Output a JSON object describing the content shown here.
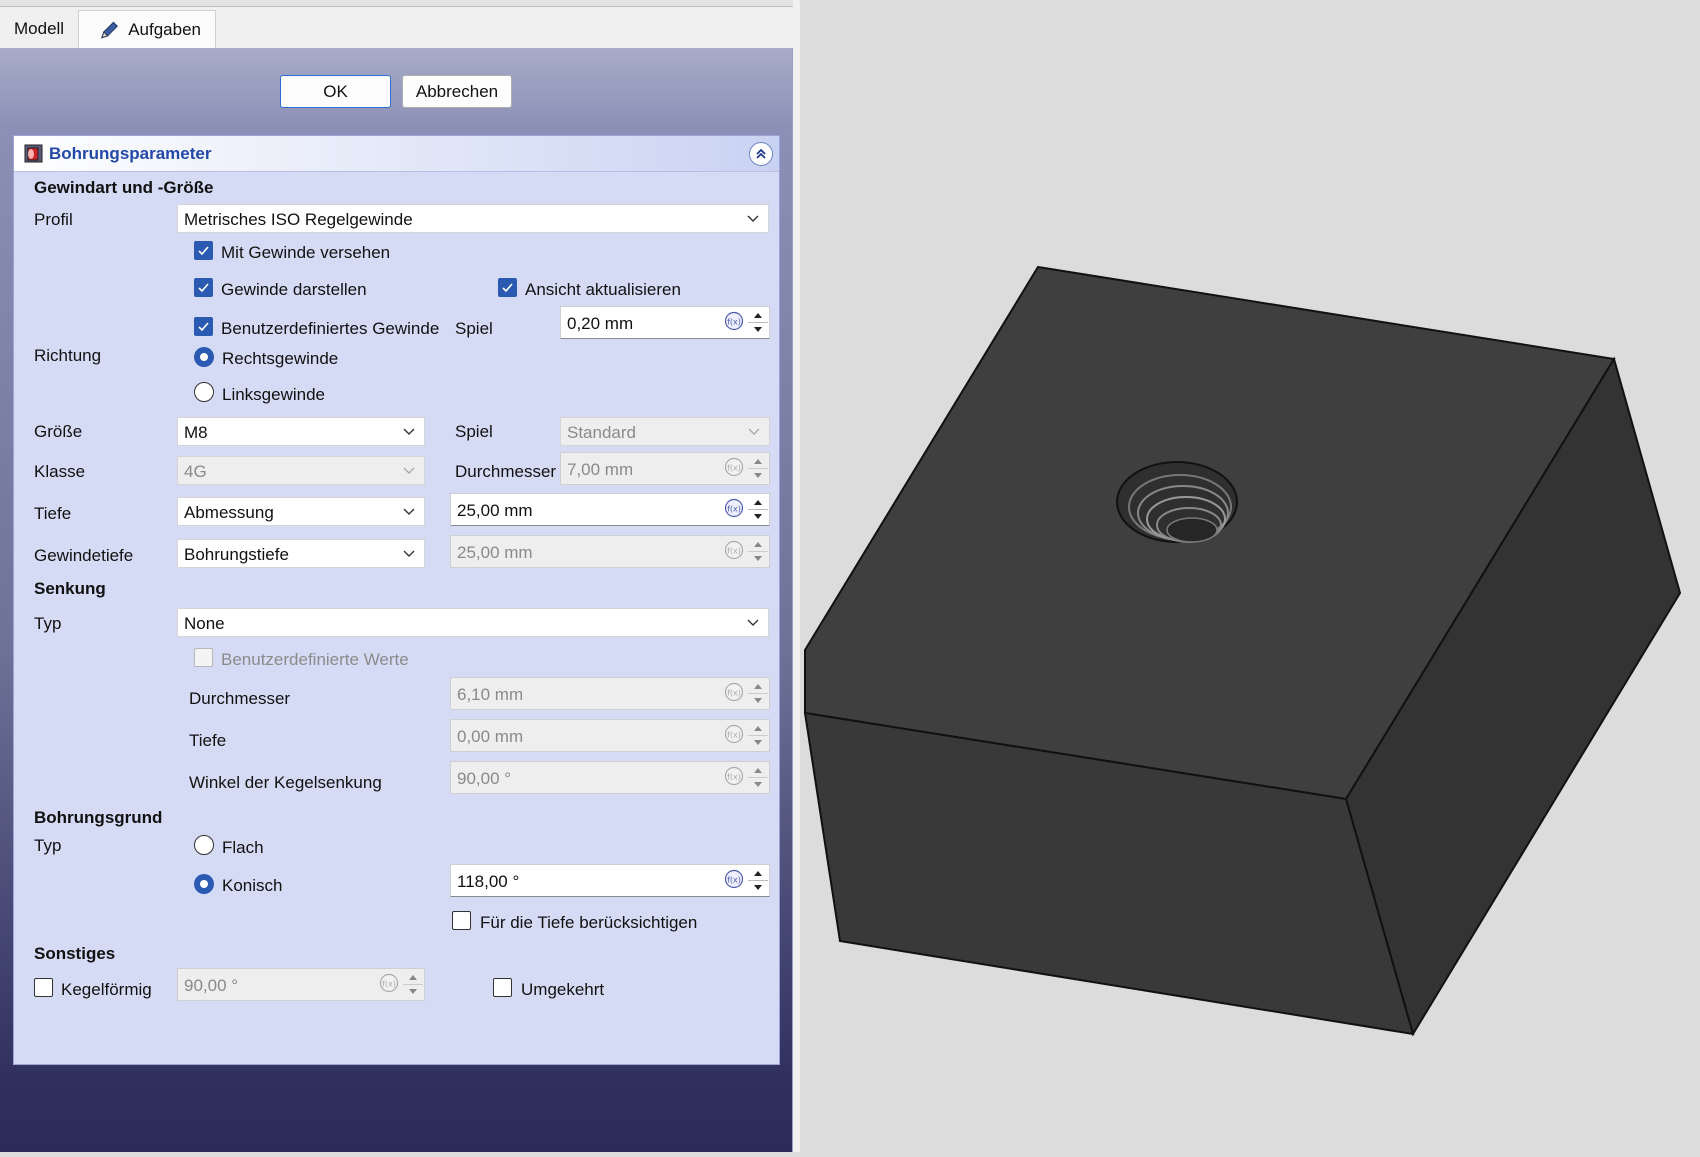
{
  "tabs": {
    "modell": "Modell",
    "aufgaben": "Aufgaben"
  },
  "buttons": {
    "ok": "OK",
    "cancel": "Abbrechen"
  },
  "panel": {
    "title": "Bohrungsparameter",
    "threading": {
      "heading": "Gewindart und -Größe",
      "profile_label": "Profil",
      "profile_value": "Metrisches ISO Regelgewinde",
      "threaded_label": "Mit Gewinde versehen",
      "model_thread_label": "Gewinde darstellen",
      "update_view_label": "Ansicht aktualisieren",
      "custom_thread_label": "Benutzerdefiniertes Gewinde",
      "clearance_label": "Spiel",
      "clearance_value": "0,20 mm",
      "direction_label": "Richtung",
      "right_hand_label": "Rechtsgewinde",
      "left_hand_label": "Linksgewinde",
      "size_label": "Größe",
      "size_value": "M8",
      "fit_label": "Spiel",
      "fit_value": "Standard",
      "class_label": "Klasse",
      "class_value": "4G",
      "diameter_label": "Durchmesser",
      "diameter_value": "7,00 mm",
      "depth_label": "Tiefe",
      "depth_type_value": "Abmessung",
      "depth_value": "25,00 mm",
      "thread_depth_label": "Gewindetiefe",
      "thread_depth_type_value": "Bohrungstiefe",
      "thread_depth_value": "25,00 mm"
    },
    "countersink": {
      "heading": "Senkung",
      "type_label": "Typ",
      "type_value": "None",
      "custom_values_label": "Benutzerdefinierte Werte",
      "diameter_label": "Durchmesser",
      "diameter_value": "6,10 mm",
      "depth_label": "Tiefe",
      "depth_value": "0,00 mm",
      "angle_label": "Winkel der Kegelsenkung",
      "angle_value": "90,00 °"
    },
    "drill_point": {
      "heading": "Bohrungsgrund",
      "type_label": "Typ",
      "flat_label": "Flach",
      "angled_label": "Konisch",
      "angle_value": "118,00 °",
      "for_depth_label": "Für die Tiefe berücksichtigen"
    },
    "misc": {
      "heading": "Sonstiges",
      "tapered_label": "Kegelförmig",
      "tapered_value": "90,00 °",
      "reversed_label": "Umgekehrt"
    }
  },
  "colors": {
    "accent": "#2a5ab2",
    "panel_bg": "#d6dbf5",
    "title_color": "#2248a8",
    "model_top": "#3f3f3f",
    "model_right": "#333333",
    "model_front": "#393939",
    "viewport_bg": "#dcdcdc"
  }
}
